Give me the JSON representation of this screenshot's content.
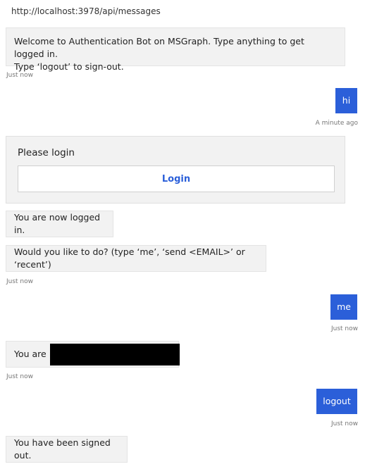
{
  "address": {
    "url": "http://localhost:3978/api/messages"
  },
  "colors": {
    "user_bubble": "#2b5fd9",
    "bot_bubble": "#f2f2f2",
    "login_text": "#2b5fd9",
    "redaction": "#000000"
  },
  "messages": {
    "welcome": {
      "line1": "Welcome to Authentication Bot on MSGraph. Type anything to get logged in.",
      "line2": "Type ‘logout’ to sign-out.",
      "timestamp": "Just now"
    },
    "user_hi": {
      "text": "hi",
      "timestamp": "A minute ago"
    },
    "login_card": {
      "title": "Please login",
      "button_label": "Login"
    },
    "logged_in": {
      "text": "You are now logged in."
    },
    "prompt": {
      "text": "Would you like to do? (type ‘me’, ‘send <EMAIL>’ or ‘recent’)",
      "timestamp": "Just now"
    },
    "user_me": {
      "text": "me",
      "timestamp": "Just now"
    },
    "you_are": {
      "text": "You are",
      "timestamp": "Just now"
    },
    "user_logout": {
      "text": "logout",
      "timestamp": "Just now"
    },
    "signed_out": {
      "text": "You have been signed out."
    }
  }
}
